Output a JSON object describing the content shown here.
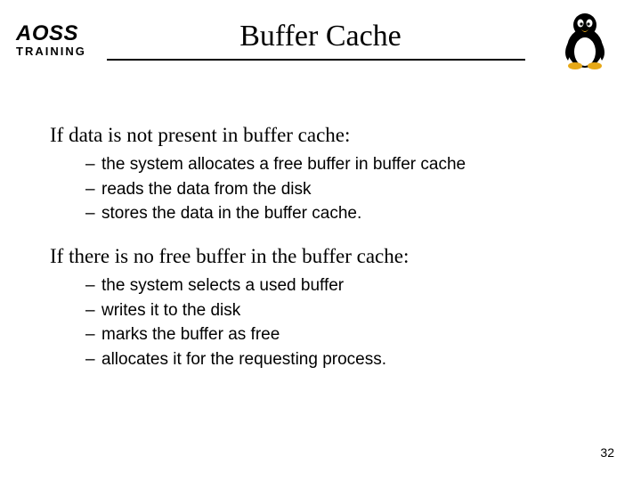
{
  "header": {
    "logo_top": "AOSS",
    "logo_bottom": "TRAINING",
    "title": "Buffer Cache"
  },
  "section1": {
    "heading": "If data is not present in buffer cache:",
    "items": [
      "the system allocates a free buffer in buffer cache",
      "reads the data from the disk",
      "stores the data in the buffer cache."
    ]
  },
  "section2": {
    "heading": "If there is no free buffer in the buffer cache:",
    "items": [
      "the system selects a used buffer",
      "writes it to the disk",
      "marks the buffer as free",
      "allocates it for the requesting process."
    ]
  },
  "page_number": "32"
}
